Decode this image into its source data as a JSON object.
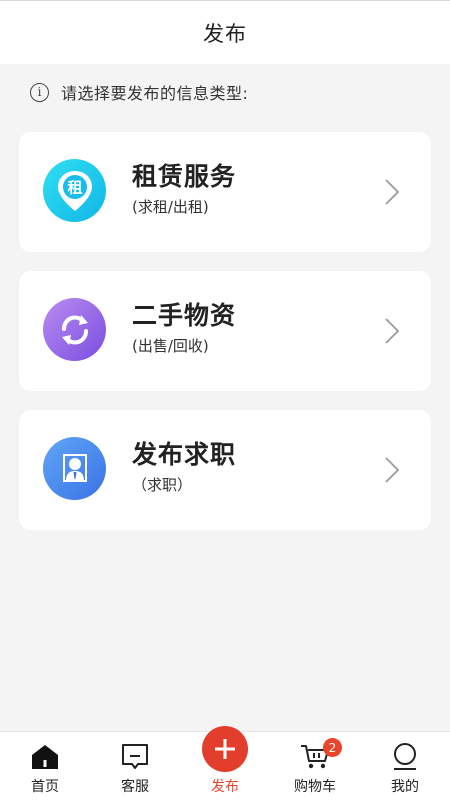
{
  "header": {
    "title": "发布"
  },
  "prompt": {
    "text": "请选择要发布的信息类型:"
  },
  "cards": [
    {
      "title": "租赁服务",
      "subtitle": "(求租/出租)",
      "icon": "rent-pin-icon",
      "icon_char": "租",
      "color": "#1ec8ec"
    },
    {
      "title": "二手物资",
      "subtitle": "(出售/回收)",
      "icon": "recycle-icon",
      "color": "#9a6cea"
    },
    {
      "title": "发布求职",
      "subtitle": "（求职）",
      "icon": "person-icon",
      "color": "#4a8cef"
    }
  ],
  "nav": {
    "items": [
      {
        "label": "首页",
        "icon": "home-icon"
      },
      {
        "label": "客服",
        "icon": "chat-icon"
      },
      {
        "label": "发布",
        "icon": "plus-icon",
        "active": true
      },
      {
        "label": "购物车",
        "icon": "cart-icon",
        "badge": "2"
      },
      {
        "label": "我的",
        "icon": "user-icon"
      }
    ],
    "active_color": "#e8452c"
  }
}
